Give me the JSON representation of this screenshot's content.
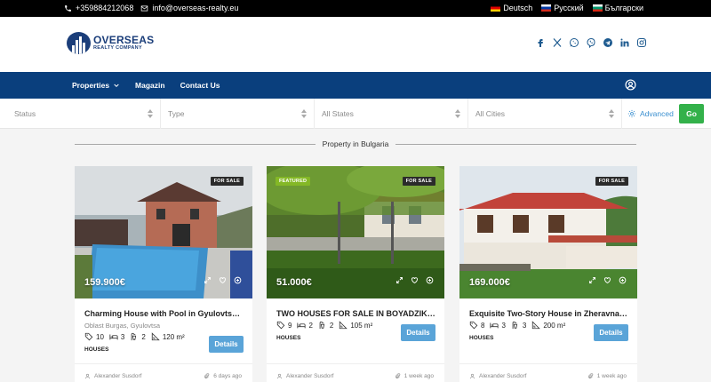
{
  "topbar": {
    "phone": "+359884212068",
    "email": "info@overseas-realty.eu",
    "languages": [
      {
        "label": "Deutsch",
        "flag": "flag-de"
      },
      {
        "label": "Русский",
        "flag": "flag-ru"
      },
      {
        "label": "Български",
        "flag": "flag-bg"
      }
    ]
  },
  "logo": {
    "line1": "OVERSEAS",
    "line2": "REALTY COMPANY"
  },
  "socials": [
    "facebook-icon",
    "x-twitter-icon",
    "whatsapp-icon",
    "viber-icon",
    "telegram-icon",
    "linkedin-icon",
    "instagram-icon"
  ],
  "nav": {
    "items": [
      {
        "label": "Properties",
        "dropdown": true
      },
      {
        "label": "Magazin",
        "dropdown": false
      },
      {
        "label": "Contact Us",
        "dropdown": false
      }
    ]
  },
  "filters": {
    "status": "Status",
    "type": "Type",
    "states": "All States",
    "cities": "All Cities",
    "advanced": "Advanced",
    "go": "Go"
  },
  "section_title": "Property in Bulgaria",
  "cards": [
    {
      "badge": "FOR SALE",
      "featured": "",
      "price": "159.900€",
      "title": "Charming House with Pool in Gyulovtsa, Bu...",
      "address": "Oblast Burgas, Gyulovtsa",
      "rooms": "10",
      "beds": "3",
      "baths": "2",
      "area": "120 m²",
      "type": "HOUSES",
      "details": "Details",
      "author": "Alexander Susdorf",
      "time": "6 days ago"
    },
    {
      "badge": "FOR SALE",
      "featured": "FEATURED",
      "price": "51.000€",
      "title": "TWO HOUSES FOR SALE IN BOYADZIK, YA...",
      "address": "",
      "rooms": "9",
      "beds": "2",
      "baths": "2",
      "area": "105 m²",
      "type": "HOUSES",
      "details": "Details",
      "author": "Alexander Susdorf",
      "time": "1 week ago"
    },
    {
      "badge": "FOR SALE",
      "featured": "",
      "price": "169.000€",
      "title": "Exquisite Two-Story House in Zheravna Arc...",
      "address": "",
      "rooms": "8",
      "beds": "3",
      "baths": "3",
      "area": "200 m²",
      "type": "HOUSES",
      "details": "Details",
      "author": "Alexander Susdorf",
      "time": "1 week ago"
    }
  ],
  "colors": {
    "nav_bg": "#0a3f7d",
    "go_button": "#33b14a",
    "details_button": "#5aa4d8",
    "featured_badge": "#84b826",
    "advanced_link": "#3a8fd0"
  }
}
